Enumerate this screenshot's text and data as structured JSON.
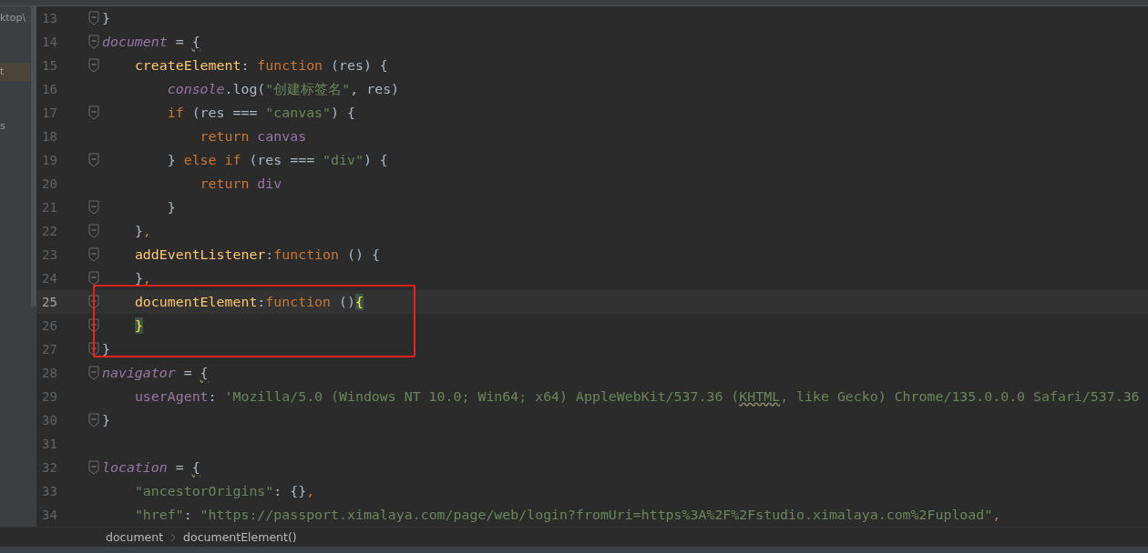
{
  "project_panel": {
    "items": [
      {
        "label": "ktop\\",
        "selected": false
      },
      {
        "label": "t",
        "selected": true
      },
      {
        "label": "s",
        "selected": false
      }
    ]
  },
  "editor": {
    "lines": [
      {
        "number": "13",
        "fold_marker": true,
        "current": false,
        "tokens": [
          {
            "kind": "plain",
            "text": "}"
          }
        ]
      },
      {
        "number": "14",
        "fold_marker": true,
        "current": false,
        "tokens": [
          {
            "kind": "global",
            "text": "document"
          },
          {
            "kind": "plain",
            "text": " = "
          },
          {
            "kind": "warn",
            "text": "{"
          }
        ]
      },
      {
        "number": "15",
        "fold_marker": true,
        "current": false,
        "tokens": [
          {
            "kind": "prop",
            "text": "    createElement"
          },
          {
            "kind": "plain",
            "text": ": "
          },
          {
            "kind": "kw",
            "text": "function"
          },
          {
            "kind": "plain",
            "text": " (res) {"
          }
        ]
      },
      {
        "number": "16",
        "fold_marker": false,
        "current": false,
        "tokens": [
          {
            "kind": "global",
            "text": "        console"
          },
          {
            "kind": "plain",
            "text": ".log("
          },
          {
            "kind": "str",
            "text": "\"创建标签名\""
          },
          {
            "kind": "plain",
            "text": ", res)"
          }
        ]
      },
      {
        "number": "17",
        "fold_marker": true,
        "current": false,
        "tokens": [
          {
            "kind": "kw",
            "text": "        if"
          },
          {
            "kind": "plain",
            "text": " (res === "
          },
          {
            "kind": "str",
            "text": "\"canvas\""
          },
          {
            "kind": "plain",
            "text": ") {"
          }
        ]
      },
      {
        "number": "18",
        "fold_marker": false,
        "current": false,
        "tokens": [
          {
            "kind": "kw",
            "text": "            return "
          },
          {
            "kind": "var",
            "text": "canvas"
          }
        ]
      },
      {
        "number": "19",
        "fold_marker": true,
        "current": false,
        "tokens": [
          {
            "kind": "plain",
            "text": "        } "
          },
          {
            "kind": "kw",
            "text": "else if"
          },
          {
            "kind": "plain",
            "text": " (res === "
          },
          {
            "kind": "str",
            "text": "\"div\""
          },
          {
            "kind": "plain",
            "text": ") {"
          }
        ]
      },
      {
        "number": "20",
        "fold_marker": false,
        "current": false,
        "tokens": [
          {
            "kind": "kw",
            "text": "            return "
          },
          {
            "kind": "var",
            "text": "div"
          }
        ]
      },
      {
        "number": "21",
        "fold_marker": true,
        "current": false,
        "tokens": [
          {
            "kind": "plain",
            "text": "        }"
          }
        ]
      },
      {
        "number": "22",
        "fold_marker": true,
        "current": false,
        "tokens": [
          {
            "kind": "plain",
            "text": "    }"
          },
          {
            "kind": "kw",
            "text": ","
          }
        ]
      },
      {
        "number": "23",
        "fold_marker": true,
        "current": false,
        "tokens": [
          {
            "kind": "prop",
            "text": "    addEventListener"
          },
          {
            "kind": "plain",
            "text": ":"
          },
          {
            "kind": "kw",
            "text": "function"
          },
          {
            "kind": "plain",
            "text": " () {"
          }
        ]
      },
      {
        "number": "24",
        "fold_marker": true,
        "current": false,
        "tokens": [
          {
            "kind": "plain",
            "text": "    }"
          },
          {
            "kind": "kw",
            "text": ","
          }
        ]
      },
      {
        "number": "25",
        "fold_marker": true,
        "current": true,
        "tokens": [
          {
            "kind": "prop",
            "text": "    documentElement"
          },
          {
            "kind": "plain",
            "text": ":"
          },
          {
            "kind": "kw",
            "text": "function"
          },
          {
            "kind": "plain",
            "text": " ()"
          },
          {
            "kind": "match",
            "text": "{"
          }
        ]
      },
      {
        "number": "26",
        "fold_marker": true,
        "current": false,
        "tokens": [
          {
            "kind": "match",
            "text": "    }"
          }
        ]
      },
      {
        "number": "27",
        "fold_marker": true,
        "current": false,
        "tokens": [
          {
            "kind": "plain",
            "text": "}"
          }
        ]
      },
      {
        "number": "28",
        "fold_marker": true,
        "current": false,
        "tokens": [
          {
            "kind": "global",
            "text": "navigator"
          },
          {
            "kind": "plain",
            "text": " = "
          },
          {
            "kind": "warn",
            "text": "{"
          }
        ]
      },
      {
        "number": "29",
        "fold_marker": false,
        "current": false,
        "tokens": [
          {
            "kind": "var",
            "text": "    userAgent"
          },
          {
            "kind": "plain",
            "text": ": "
          },
          {
            "kind": "str",
            "text": "'Mozilla/5.0 (Windows NT 10.0; Win64; x64) AppleWebKit/537.36 ("
          },
          {
            "kind": "strwarn",
            "text": "KHTML"
          },
          {
            "kind": "str",
            "text": ", like Gecko) Chrome/135.0.0.0 Safari/537.36"
          }
        ]
      },
      {
        "number": "30",
        "fold_marker": true,
        "current": false,
        "tokens": [
          {
            "kind": "plain",
            "text": "}"
          }
        ]
      },
      {
        "number": "31",
        "fold_marker": false,
        "current": false
      },
      {
        "number": "32",
        "fold_marker": true,
        "current": false,
        "tokens": [
          {
            "kind": "global",
            "text": "location"
          },
          {
            "kind": "plain",
            "text": " = "
          },
          {
            "kind": "warn",
            "text": "{"
          }
        ]
      },
      {
        "number": "33",
        "fold_marker": false,
        "current": false,
        "tokens": [
          {
            "kind": "str",
            "text": "    \"ancestorOrigins\""
          },
          {
            "kind": "plain",
            "text": ": {}"
          },
          {
            "kind": "kw",
            "text": ","
          }
        ]
      },
      {
        "number": "34",
        "fold_marker": false,
        "current": false,
        "tokens": [
          {
            "kind": "str",
            "text": "    \"href\""
          },
          {
            "kind": "plain",
            "text": ": "
          },
          {
            "kind": "str",
            "text": "\"https://passport.ximalaya.com/page/web/login?fromUri=https%3A%2F%2Fstudio.ximalaya.com%2Fupload\""
          },
          {
            "kind": "kw",
            "text": ","
          }
        ]
      }
    ]
  },
  "breadcrumb": [
    "document",
    "documentElement()"
  ]
}
